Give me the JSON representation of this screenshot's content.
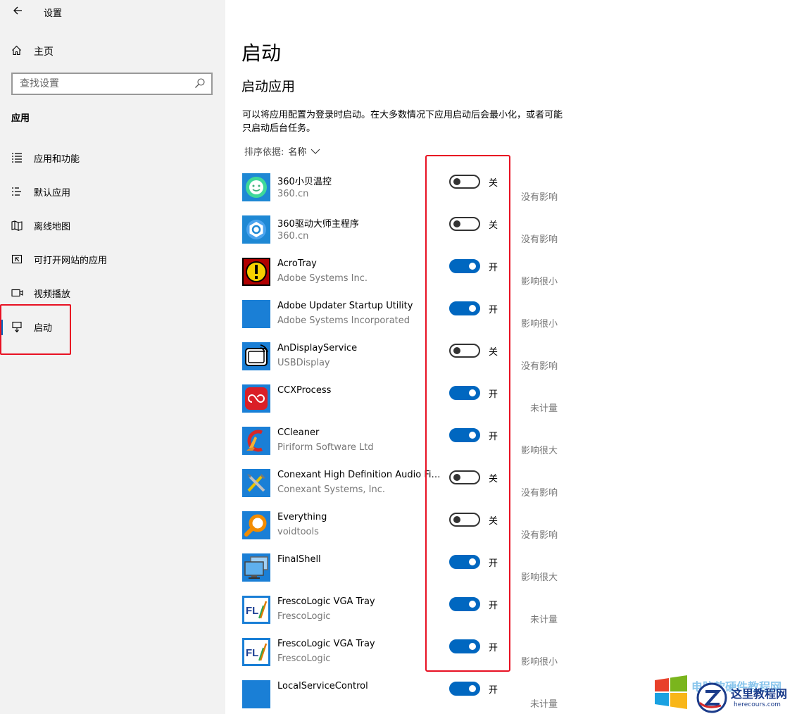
{
  "window": {
    "title": "设置"
  },
  "sidebar": {
    "home_label": "主页",
    "search_placeholder": "查找设置",
    "section_label": "应用",
    "items": [
      {
        "label": "应用和功能",
        "icon": "list-icon"
      },
      {
        "label": "默认应用",
        "icon": "default-apps-icon"
      },
      {
        "label": "离线地图",
        "icon": "map-icon"
      },
      {
        "label": "可打开网站的应用",
        "icon": "open-website-icon"
      },
      {
        "label": "视频播放",
        "icon": "video-icon"
      },
      {
        "label": "启动",
        "icon": "startup-icon",
        "active": true
      }
    ]
  },
  "main": {
    "page_title": "启动",
    "section_title": "启动应用",
    "description": "可以将应用配置为登录时启动。在大多数情况下应用启动后会最小化，或者可能只启动后台任务。",
    "sort_label": "排序依据:",
    "sort_value": "名称"
  },
  "apps": [
    {
      "name": "360小贝温控",
      "publisher": "360.cn",
      "on": false,
      "state": "关",
      "impact": "没有影响",
      "icon": "360-temp-icon"
    },
    {
      "name": "360驱动大师主程序",
      "publisher": "360.cn",
      "on": false,
      "state": "关",
      "impact": "没有影响",
      "icon": "360-driver-icon"
    },
    {
      "name": "AcroTray",
      "publisher": "Adobe Systems Inc.",
      "on": true,
      "state": "开",
      "impact": "影响很小",
      "icon": "acrotray-icon"
    },
    {
      "name": "Adobe Updater Startup Utility",
      "publisher": "Adobe Systems Incorporated",
      "on": true,
      "state": "开",
      "impact": "影响很小",
      "icon": "adobe-updater-icon"
    },
    {
      "name": "AnDisplayService",
      "publisher": "USBDisplay",
      "on": false,
      "state": "关",
      "impact": "没有影响",
      "icon": "usb-display-icon"
    },
    {
      "name": "CCXProcess",
      "publisher": "",
      "on": true,
      "state": "开",
      "impact": "未计量",
      "icon": "creative-cloud-icon"
    },
    {
      "name": "CCleaner",
      "publisher": "Piriform Software Ltd",
      "on": true,
      "state": "开",
      "impact": "影响很大",
      "icon": "ccleaner-icon"
    },
    {
      "name": "Conexant High Definition Audio Filt...",
      "publisher": "Conexant Systems, Inc.",
      "on": false,
      "state": "关",
      "impact": "没有影响",
      "icon": "tools-icon"
    },
    {
      "name": "Everything",
      "publisher": "voidtools",
      "on": false,
      "state": "关",
      "impact": "没有影响",
      "icon": "magnifier-icon"
    },
    {
      "name": "FinalShell",
      "publisher": "",
      "on": true,
      "state": "开",
      "impact": "影响很大",
      "icon": "monitor-icon"
    },
    {
      "name": "FrescoLogic VGA Tray",
      "publisher": "FrescoLogic",
      "on": true,
      "state": "开",
      "impact": "未计量",
      "icon": "fresco-logic-icon"
    },
    {
      "name": "FrescoLogic VGA Tray",
      "publisher": "FrescoLogic",
      "on": true,
      "state": "开",
      "impact": "影响很小",
      "icon": "fresco-logic-icon"
    },
    {
      "name": "LocalServiceControl",
      "publisher": "",
      "on": true,
      "state": "开",
      "impact": "未计量",
      "icon": "blank-app-icon"
    }
  ],
  "watermark": {
    "site": "这里教程网",
    "domain": "herecours.com",
    "faded_text": "电脑软硬件教程网"
  },
  "colors": {
    "accent": "#0067c0",
    "highlight": "#e81123",
    "sidebar_bg": "#f2f2f2"
  }
}
